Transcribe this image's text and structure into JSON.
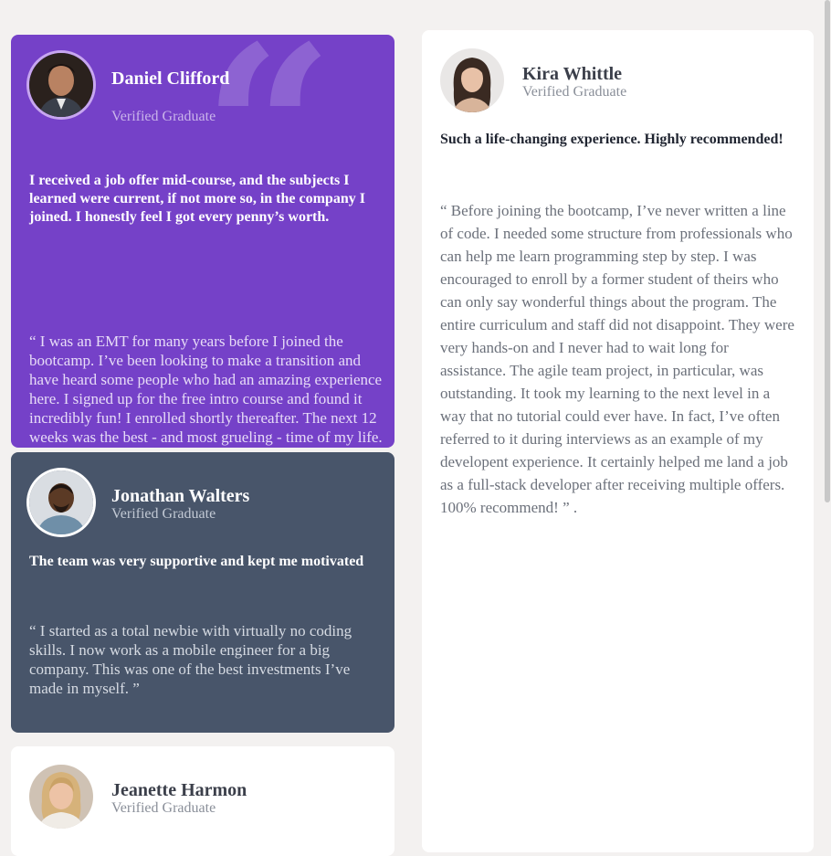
{
  "testimonials": {
    "daniel": {
      "name": "Daniel Clifford",
      "role": "Verified Graduate",
      "headline": "I received a job offer mid-course, and the subjects I learned were current, if not more so, in the company I joined. I honestly feel I got every penny’s worth.",
      "body": "“ I was an EMT for many years before I joined the bootcamp. I’ve been looking to make a transition and have heard some people who had an amazing experience here. I signed up for the free intro course and found it incredibly fun! I enrolled shortly thereafter. The next 12 weeks was the best - and most grueling - time of my life. Since completing the course, I’ve successfully switched careers, working as a Software Engineer at a VR startup. ”",
      "quote_glyph": "“",
      "bg": "#7541c8"
    },
    "jonathan": {
      "name": "Jonathan Walters",
      "role": "Verified Graduate",
      "headline": "The team was very supportive and kept me motivated",
      "body": "“ I started as a total newbie with virtually no coding skills. I now work as a mobile engineer for a big company. This was one of the best investments I’ve made in myself. ”",
      "bg": "#48556a"
    },
    "jeanette": {
      "name": "Jeanette Harmon",
      "role": "Verified Graduate",
      "bg": "#ffffff"
    },
    "kira": {
      "name": "Kira Whittle",
      "role": "Verified Graduate",
      "headline": "Such a life-changing experience. Highly recommended!",
      "body": "“ Before joining the bootcamp, I’ve never written a line of code. I needed some structure from professionals who can help me learn programming step by step. I was encouraged to enroll by a former student of theirs who can only say wonderful things about the program. The entire curriculum and staff did not disappoint. They were very hands-on and I never had to wait long for assistance. The agile team project, in particular, was outstanding. It took my learning to the next level in a way that no tutorial could ever have. In fact, I’ve often referred to it during interviews as an example of my developent experience. It certainly helped me land a job as a full-stack developer after receiving multiple offers. 100% recommend! ” .",
      "bg": "#ffffff"
    }
  },
  "colors": {
    "page_bg": "#f3f1f0",
    "purple": "#7541c8",
    "slate": "#48556a"
  }
}
